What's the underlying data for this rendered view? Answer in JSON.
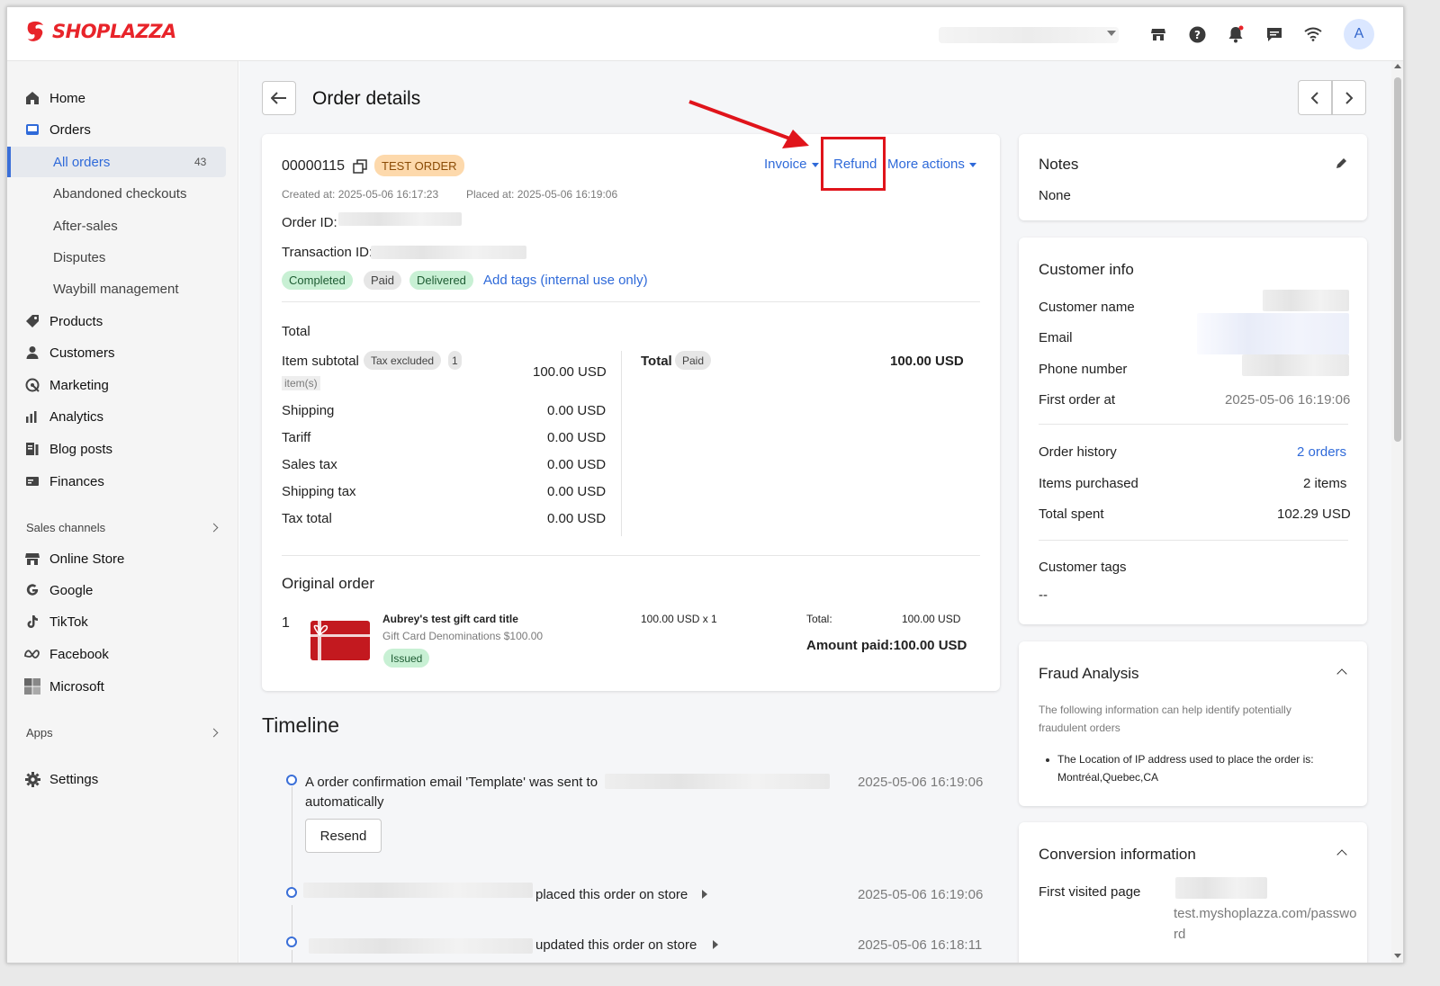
{
  "topbar": {
    "brand": "SHOPLAZZA",
    "icons": [
      "store-icon",
      "help-icon",
      "bell-icon",
      "chat-icon",
      "wifi-icon"
    ],
    "avatar_initial": "A",
    "accent": "#e8242a"
  },
  "sidebar": {
    "items": [
      {
        "label": "Home",
        "icon": "home-icon"
      },
      {
        "label": "Orders",
        "icon": "orders-icon"
      },
      {
        "label": "All orders",
        "count": "43"
      },
      {
        "label": "Abandoned checkouts"
      },
      {
        "label": "After-sales"
      },
      {
        "label": "Disputes"
      },
      {
        "label": "Waybill management"
      },
      {
        "label": "Products",
        "icon": "tag-icon"
      },
      {
        "label": "Customers",
        "icon": "person-icon"
      },
      {
        "label": "Marketing",
        "icon": "marketing-icon"
      },
      {
        "label": "Analytics",
        "icon": "bar-chart-icon"
      },
      {
        "label": "Blog posts",
        "icon": "blog-icon"
      },
      {
        "label": "Finances",
        "icon": "finance-icon"
      }
    ],
    "sales_channels_label": "Sales channels",
    "channels": [
      {
        "label": "Online Store",
        "icon": "store-icon"
      },
      {
        "label": "Google",
        "icon": "google-icon"
      },
      {
        "label": "TikTok",
        "icon": "tiktok-icon"
      },
      {
        "label": "Facebook",
        "icon": "meta-icon"
      },
      {
        "label": "Microsoft",
        "icon": "microsoft-icon"
      }
    ],
    "apps_label": "Apps",
    "settings_label": "Settings"
  },
  "header": {
    "title": "Order details"
  },
  "order": {
    "number": "00000115",
    "test_badge": "TEST ORDER",
    "invoice_label": "Invoice",
    "refund_label": "Refund",
    "more_actions_label": "More actions",
    "created_label": "Created at:",
    "created_value": "2025-05-06 16:17:23",
    "placed_label": "Placed at:",
    "placed_value": "2025-05-06 16:19:06",
    "order_id_label": "Order ID:",
    "transaction_id_label": "Transaction ID:",
    "tags": [
      "Completed",
      "Paid",
      "Delivered"
    ],
    "add_tags_label": "Add tags (internal use only)"
  },
  "totals": {
    "heading": "Total",
    "item_subtotal_label": "Item subtotal",
    "tax_excluded_badge": "Tax excluded",
    "item_count": "1",
    "items_word": "item(s)",
    "item_subtotal_value": "100.00 USD",
    "rows": [
      {
        "label": "Shipping",
        "value": "0.00 USD"
      },
      {
        "label": "Tariff",
        "value": "0.00 USD"
      },
      {
        "label": "Sales tax",
        "value": "0.00 USD"
      },
      {
        "label": "Shipping tax",
        "value": "0.00 USD"
      },
      {
        "label": "Tax total",
        "value": "0.00 USD"
      }
    ],
    "total_label": "Total",
    "paid_badge": "Paid",
    "total_value": "100.00 USD"
  },
  "original_order": {
    "heading": "Original order",
    "index": "1",
    "product_title": "Aubrey's test gift card title",
    "variant": "Gift Card Denominations $100.00",
    "status_badge": "Issued",
    "price_qty": "100.00 USD x 1",
    "total_label": "Total:",
    "total_value": "100.00 USD",
    "amount_paid": "Amount paid:100.00 USD"
  },
  "timeline": {
    "heading": "Timeline",
    "events": [
      {
        "text": "A order confirmation email 'Template' was sent to",
        "text2": "automatically",
        "time": "2025-05-06 16:19:06",
        "button": "Resend"
      },
      {
        "text": "placed this order on store",
        "time": "2025-05-06 16:19:06"
      },
      {
        "text": "updated this order on store",
        "time": "2025-05-06 16:18:11"
      }
    ]
  },
  "notes": {
    "heading": "Notes",
    "value": "None"
  },
  "customer": {
    "heading": "Customer info",
    "name_label": "Customer name",
    "email_label": "Email",
    "phone_label": "Phone number",
    "first_order_label": "First order at",
    "first_order_value": "2025-05-06 16:19:06",
    "order_history_label": "Order history",
    "order_history_value": "2 orders",
    "items_purchased_label": "Items purchased",
    "items_purchased_value": "2 items",
    "total_spent_label": "Total spent",
    "total_spent_value": "102.29 USD",
    "tags_label": "Customer tags",
    "tags_value": "--"
  },
  "fraud": {
    "heading": "Fraud Analysis",
    "description": "The following information can help identify potentially fraudulent orders",
    "bullet_line1": "The Location of IP address used to place the order is:",
    "bullet_line2": "Montréal,Quebec,CA"
  },
  "conversion": {
    "heading": "Conversion information",
    "first_visited_label": "First visited page",
    "first_visited_line1": "test.myshoplazza.com/passwo",
    "first_visited_line2": "rd"
  },
  "annotation": {
    "highlight_color": "#e0141b"
  }
}
